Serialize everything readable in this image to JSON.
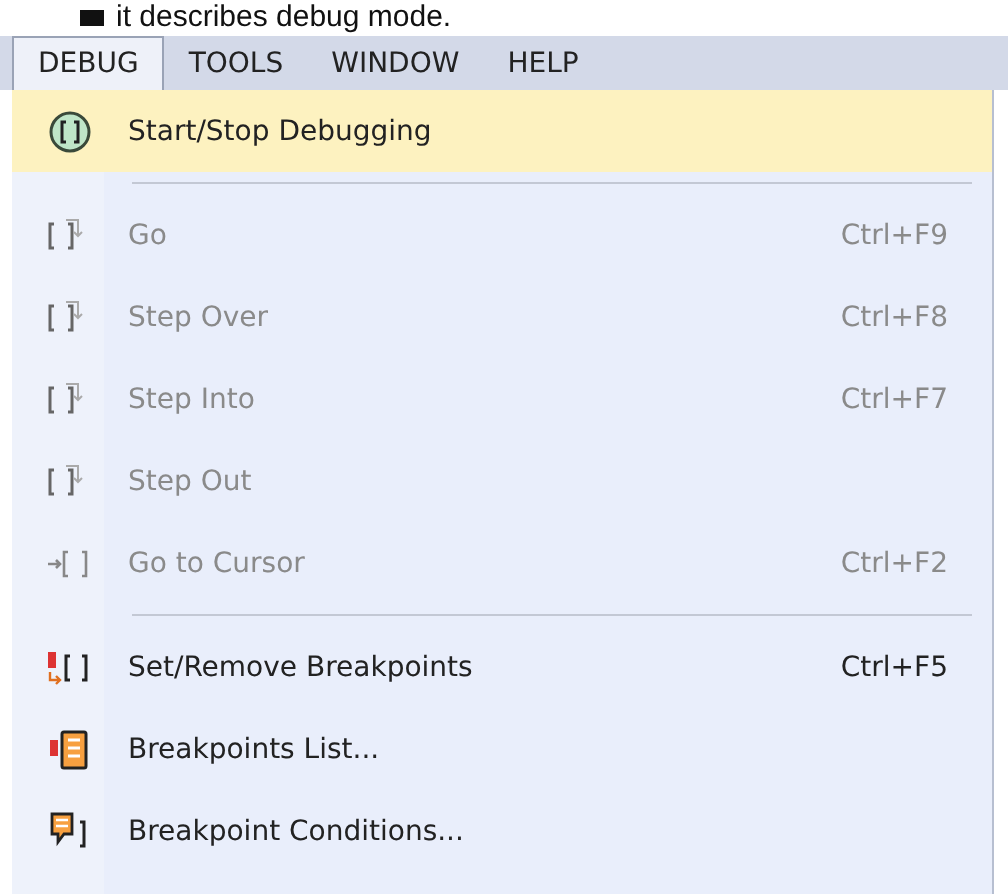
{
  "caption": "it describes debug mode.",
  "menubar": [
    {
      "label": "DEBUG",
      "selected": true
    },
    {
      "label": "TOOLS",
      "selected": false
    },
    {
      "label": "WINDOW",
      "selected": false
    },
    {
      "label": "HELP",
      "selected": false
    }
  ],
  "menu": [
    {
      "kind": "command",
      "label": "Start/Stop Debugging",
      "highlighted": true,
      "disabled": false
    },
    {
      "kind": "separator"
    },
    {
      "kind": "command",
      "label": "Go",
      "shortcut": "Ctrl+F9",
      "highlighted": false,
      "disabled": true
    },
    {
      "kind": "command",
      "label": "Step Over",
      "shortcut": "Ctrl+F8",
      "highlighted": false,
      "disabled": true
    },
    {
      "kind": "command",
      "label": "Step Into",
      "shortcut": "Ctrl+F7",
      "highlighted": false,
      "disabled": true
    },
    {
      "kind": "command",
      "label": "Step Out",
      "highlighted": false,
      "disabled": true
    },
    {
      "kind": "command",
      "label": "Go to Cursor",
      "shortcut": "Ctrl+F2",
      "highlighted": false,
      "disabled": true
    },
    {
      "kind": "separator"
    },
    {
      "kind": "command",
      "label": "Set/Remove Breakpoints",
      "shortcut": "Ctrl+F5",
      "highlighted": false,
      "disabled": false
    },
    {
      "kind": "command",
      "label": "Breakpoints List...",
      "highlighted": false,
      "disabled": false
    },
    {
      "kind": "command",
      "label": "Breakpoint Conditions...",
      "highlighted": false,
      "disabled": false
    }
  ]
}
